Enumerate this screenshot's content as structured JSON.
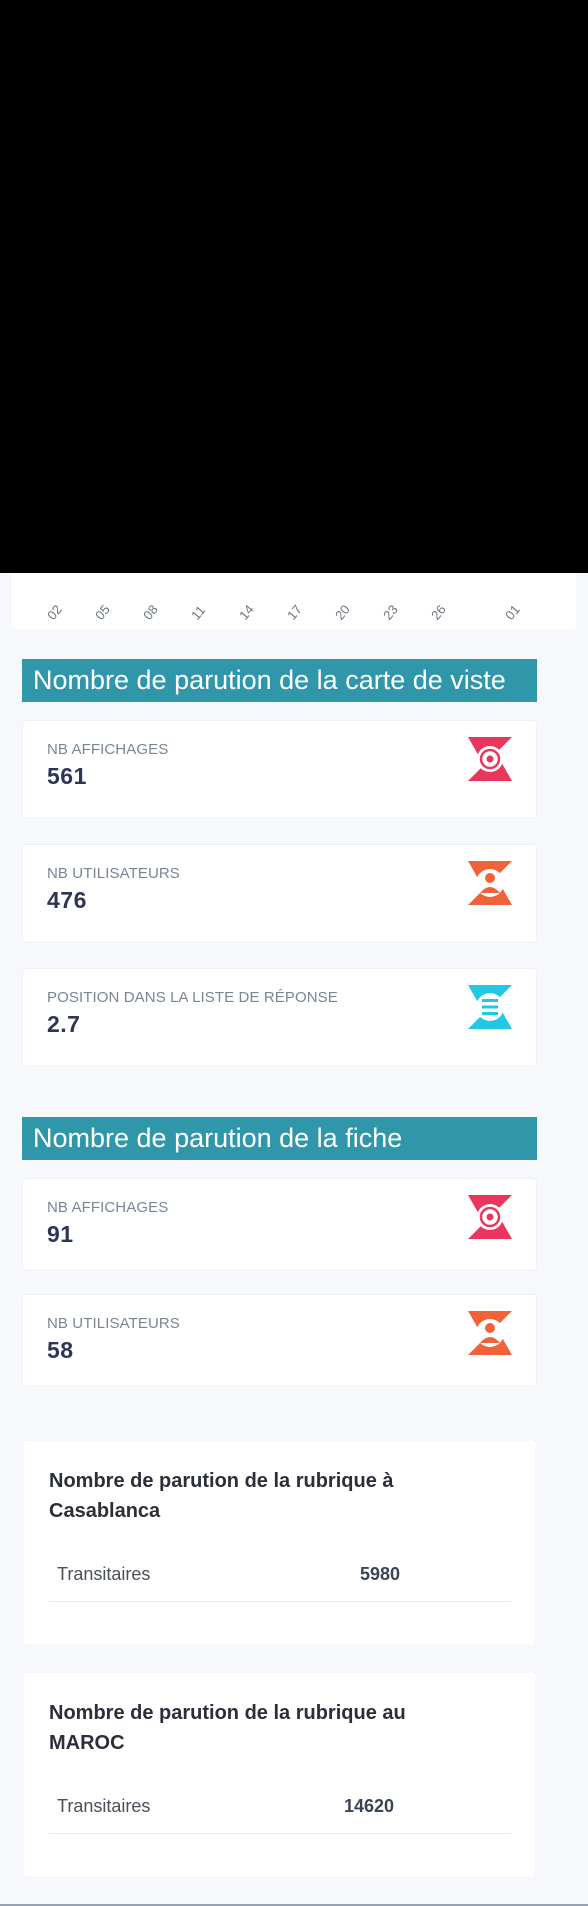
{
  "chart_ticks": [
    "02",
    "05",
    "08",
    "11",
    "14",
    "17",
    "20",
    "23",
    "26",
    "01"
  ],
  "section_vcard": {
    "title": "Nombre de parution de la carte de viste",
    "stats": [
      {
        "label": "NB AFFICHAGES",
        "value": "561",
        "icon": "eye-icon",
        "color": "#e8365d"
      },
      {
        "label": "NB UTILISATEURS",
        "value": "476",
        "icon": "users-icon",
        "color": "#f0633a"
      },
      {
        "label": "POSITION DANS LA LISTE DE RÉPONSE",
        "value": "2.7",
        "icon": "list-icon",
        "color": "#1fc8e3"
      }
    ]
  },
  "section_fiche": {
    "title": "Nombre de parution de la fiche",
    "stats": [
      {
        "label": "NB AFFICHAGES",
        "value": "91",
        "icon": "eye-icon",
        "color": "#e8365d"
      },
      {
        "label": "NB UTILISATEURS",
        "value": "58",
        "icon": "users-icon",
        "color": "#f0633a"
      }
    ]
  },
  "rubrique_casa": {
    "title": "Nombre de parution de la rubrique à Casablanca",
    "row": {
      "name": "Transitaires",
      "count": "5980"
    }
  },
  "rubrique_maroc": {
    "title": "Nombre de parution de la rubrique au MAROC",
    "row": {
      "name": "Transitaires",
      "count": "14620"
    }
  }
}
